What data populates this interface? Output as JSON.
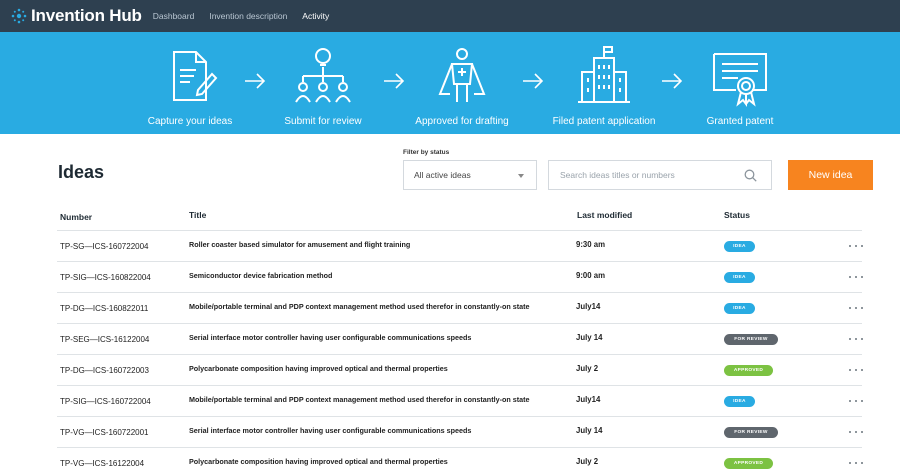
{
  "app": {
    "name": "Invention Hub"
  },
  "nav": [
    {
      "label": "Dashboard",
      "active": false
    },
    {
      "label": "Invention description",
      "active": false
    },
    {
      "label": "Activity",
      "active": true
    }
  ],
  "workflow": [
    {
      "label": "Capture your ideas",
      "icon": "document-pen-icon"
    },
    {
      "label": "Submit for review",
      "icon": "lightbulb-org-chart-icon"
    },
    {
      "label": "Approved for drafting",
      "icon": "hero-figure-icon"
    },
    {
      "label": "Filed patent application",
      "icon": "building-flag-icon"
    },
    {
      "label": "Granted patent",
      "icon": "certificate-icon"
    }
  ],
  "page": {
    "title": "Ideas",
    "filter_label": "Filter by status",
    "filter_value": "All active ideas",
    "search_placeholder": "Search ideas titles or numbers",
    "new_button": "New idea"
  },
  "table": {
    "headers": {
      "number": "Number",
      "title": "Title",
      "modified": "Last modified",
      "status": "Status"
    },
    "rows": [
      {
        "number": "TP-SG—ICS-160722004",
        "title": "Roller coaster based simulator for amusement and flight training",
        "modified": "9:30 am",
        "status": "IDEA"
      },
      {
        "number": "TP-SIG—ICS-160822004",
        "title": "Semiconductor device fabrication method",
        "modified": "9:00 am",
        "status": "IDEA"
      },
      {
        "number": "TP-DG—ICS-160822011",
        "title": "Mobile/portable terminal and PDP context management method used therefor in constantly-on state",
        "modified": "July14",
        "status": "IDEA"
      },
      {
        "number": "TP-SEG—ICS-16122004",
        "title": "Serial interface motor controller having user configurable communications speeds",
        "modified": "July 14",
        "status": "FOR REVIEW"
      },
      {
        "number": "TP-DG—ICS-160722003",
        "title": "Polycarbonate composition having improved optical and thermal properties",
        "modified": "July 2",
        "status": "APPROVED"
      },
      {
        "number": "TP-SIG—ICS-160722004",
        "title": "Mobile/portable terminal and PDP context management method used therefor in constantly-on state",
        "modified": "July14",
        "status": "IDEA"
      },
      {
        "number": "TP-VG—ICS-160722001",
        "title": "Serial interface motor controller having user configurable communications speeds",
        "modified": "July 14",
        "status": "FOR REVIEW"
      },
      {
        "number": "TP-VG—ICS-16122004",
        "title": "Polycarbonate composition having improved optical and thermal properties",
        "modified": "July 2",
        "status": "APPROVED"
      }
    ]
  },
  "colors": {
    "topbar": "#2e4050",
    "banner": "#29abe2",
    "primary_button": "#f7841f",
    "status_idea": "#29abe2",
    "status_for_review": "#5f666d",
    "status_approved": "#7cc242"
  }
}
